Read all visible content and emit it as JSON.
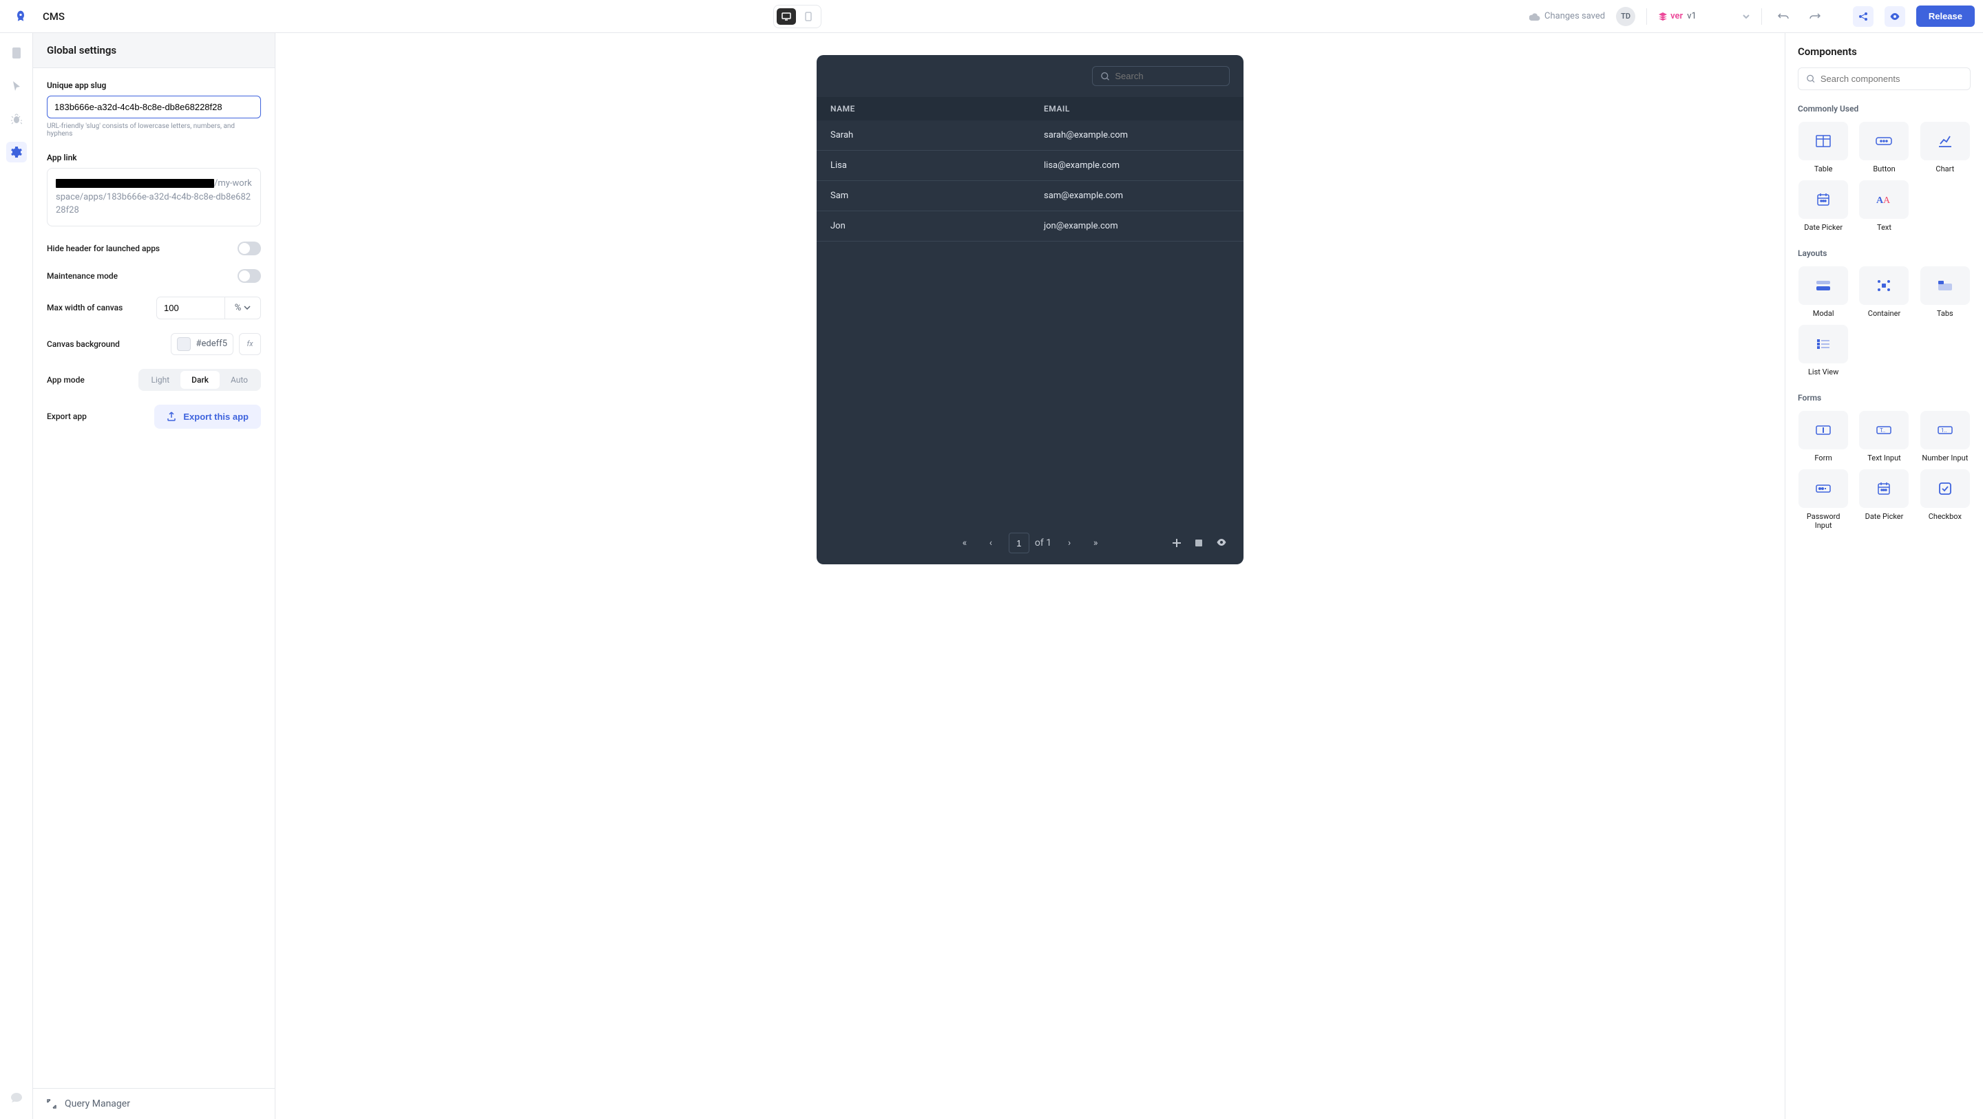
{
  "topbar": {
    "app_name": "CMS",
    "saved_text": "Changes saved",
    "avatar_initials": "TD",
    "version_prefix": "ver",
    "version_value": "v1",
    "release_label": "Release"
  },
  "settings": {
    "title": "Global settings",
    "slug_label": "Unique app slug",
    "slug_value": "183b666e-a32d-4c4b-8c8e-db8e68228f28",
    "slug_help": "URL-friendly 'slug' consists of lowercase letters, numbers, and hyphens",
    "link_label": "App link",
    "link_suffix": "/my-workspace/apps/183b666e-a32d-4c4b-8c8e-db8e68228f28",
    "hide_header_label": "Hide header for launched apps",
    "maintenance_label": "Maintenance mode",
    "max_width_label": "Max width of canvas",
    "max_width_value": "100",
    "max_width_unit": "%",
    "bg_label": "Canvas background",
    "bg_value": "#edeff5",
    "mode_label": "App mode",
    "mode_options": {
      "light": "Light",
      "dark": "Dark",
      "auto": "Auto"
    },
    "export_label": "Export app",
    "export_btn": "Export this app",
    "query_manager": "Query Manager"
  },
  "table": {
    "search_placeholder": "Search",
    "columns": {
      "name": "NAME",
      "email": "EMAIL"
    },
    "rows": [
      {
        "name": "Sarah",
        "email": "sarah@example.com"
      },
      {
        "name": "Lisa",
        "email": "lisa@example.com"
      },
      {
        "name": "Sam",
        "email": "sam@example.com"
      },
      {
        "name": "Jon",
        "email": "jon@example.com"
      }
    ],
    "page_current": "1",
    "page_total": "of 1"
  },
  "components": {
    "title": "Components",
    "search_placeholder": "Search components",
    "section_common": "Commonly Used",
    "section_layouts": "Layouts",
    "section_forms": "Forms",
    "items": {
      "table": "Table",
      "button": "Button",
      "chart": "Chart",
      "date_picker": "Date Picker",
      "text": "Text",
      "modal": "Modal",
      "container": "Container",
      "tabs": "Tabs",
      "list_view": "List View",
      "form": "Form",
      "text_input": "Text Input",
      "number_input": "Number Input",
      "password_input": "Password Input",
      "date_picker2": "Date Picker",
      "checkbox": "Checkbox"
    }
  }
}
